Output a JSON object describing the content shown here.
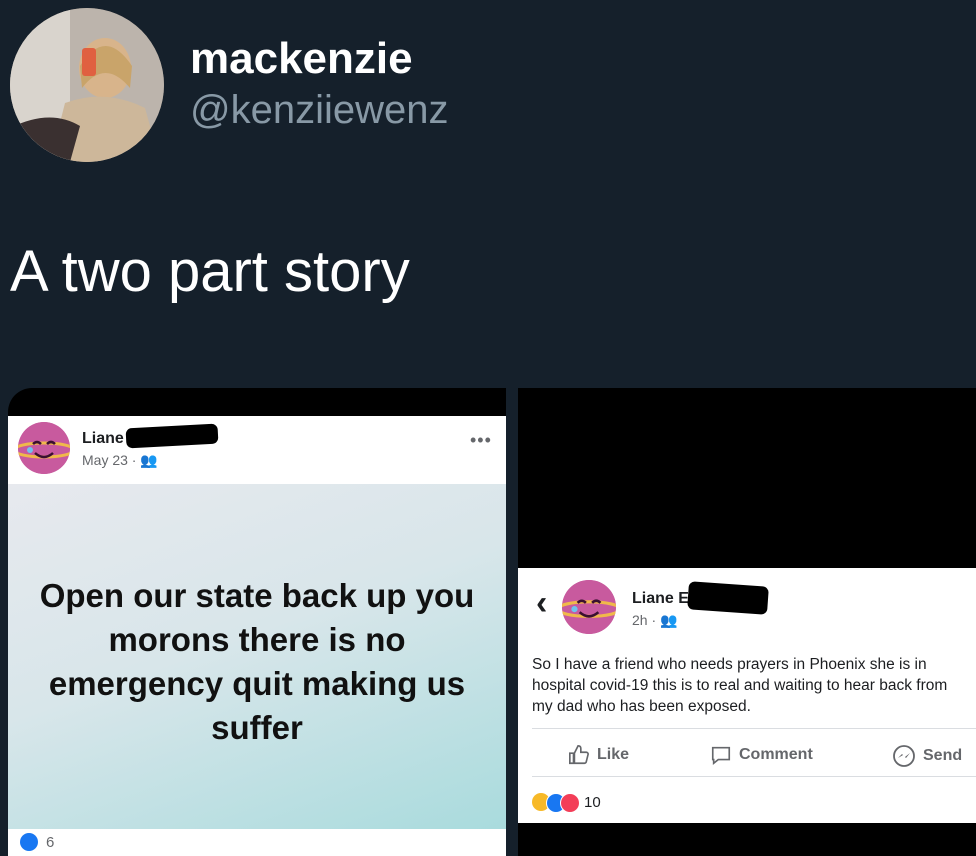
{
  "tweet": {
    "name": "mackenzie",
    "handle": "@kenziiewenz",
    "text": "A two part story"
  },
  "post1": {
    "author": "Liane",
    "meta": "May 23 · ",
    "menu": "•••",
    "body": "Open our state back up you morons there is no emergency quit making us suffer",
    "reaction_count": "6"
  },
  "post2": {
    "back": "‹",
    "author": "Liane E",
    "meta": "2h · ",
    "body": "So I have a friend who needs prayers in Phoenix she is in hospital covid-19 this is to real and waiting to hear back from my dad who has been exposed.",
    "actions": {
      "like": "Like",
      "comment": "Comment",
      "send": "Send"
    },
    "reaction_count": "10"
  },
  "colors": {
    "background": "#15202b",
    "handle": "#8899a6",
    "fb_like": "#1877f2",
    "fb_love": "#f33e58"
  }
}
